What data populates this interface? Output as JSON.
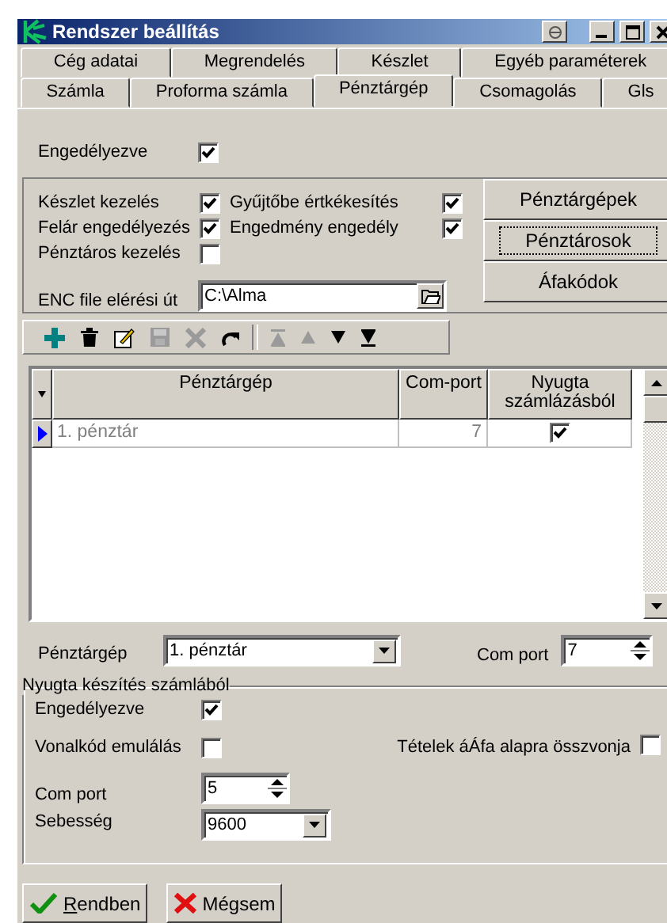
{
  "window": {
    "title": "Rendszer beállítás"
  },
  "tab_rows": [
    [
      {
        "label": "Cég adatai",
        "selected": false
      },
      {
        "label": "Megrendelés",
        "selected": false
      },
      {
        "label": "Készlet",
        "selected": false
      },
      {
        "label": "Egyéb paraméterek",
        "selected": false
      }
    ],
    [
      {
        "label": "Számla",
        "selected": false
      },
      {
        "label": "Proforma számla",
        "selected": false
      },
      {
        "label": "Pénztárgép",
        "selected": true
      },
      {
        "label": "Csomagolás",
        "selected": false
      },
      {
        "label": "Gls",
        "selected": false
      }
    ]
  ],
  "enabled": {
    "label": "Engedélyezve",
    "checked": true
  },
  "option_rows": [
    [
      {
        "label": "Készlet kezelés",
        "checked": true
      },
      {
        "label": "Gyűjtőbe értkékesítés",
        "checked": true
      }
    ],
    [
      {
        "label": "Felár engedélyezés",
        "checked": true
      },
      {
        "label": "Engedmény engedély",
        "checked": true
      }
    ],
    [
      {
        "label": "Pénztáros kezelés",
        "checked": false
      }
    ]
  ],
  "side_buttons": [
    {
      "label": "Pénztárgépek",
      "focused": false
    },
    {
      "label": "Pénztárosok",
      "focused": true
    },
    {
      "label": "Áfakódok",
      "focused": false
    }
  ],
  "enc_path": {
    "label": "ENC file elérési út",
    "value": "C:\\Alma"
  },
  "toolbar": [
    {
      "kind": "add",
      "disabled": false
    },
    {
      "kind": "delete",
      "disabled": false
    },
    {
      "kind": "edit",
      "disabled": false
    },
    {
      "kind": "save",
      "disabled": true
    },
    {
      "kind": "cancel",
      "disabled": true
    },
    {
      "kind": "refresh",
      "disabled": false
    },
    {
      "kind": "first",
      "disabled": true
    },
    {
      "kind": "prev",
      "disabled": true
    },
    {
      "kind": "next",
      "disabled": false
    },
    {
      "kind": "last",
      "disabled": false
    }
  ],
  "grid": {
    "columns": [
      "Pénztárgép",
      "Com-port",
      "Nyugta számlázásból"
    ],
    "rows": [
      {
        "name": "1. pénztár",
        "com_port": "7",
        "receipt": true,
        "selected": true
      }
    ]
  },
  "selector": {
    "label": "Pénztárgép",
    "value": "1. pénztár",
    "com_label": "Com port",
    "com_value": "7"
  },
  "receipt_group": {
    "title": "Nyugta készítés számlából",
    "enabled": {
      "label": "Engedélyezve",
      "checked": true
    },
    "barcode": {
      "label": "Vonalkód emulálás",
      "checked": false
    },
    "vat": {
      "label": "Tételek áÁfa alapra összvonja",
      "checked": false
    },
    "com_port": {
      "label": "Com port",
      "value": "5"
    },
    "speed": {
      "label": "Sebesség",
      "value": "9600"
    }
  },
  "buttons": [
    {
      "label": "Rendben",
      "kind": "ok",
      "mnemonic": true
    },
    {
      "label": "Mégsem",
      "kind": "cancel",
      "mnemonic": false
    }
  ]
}
